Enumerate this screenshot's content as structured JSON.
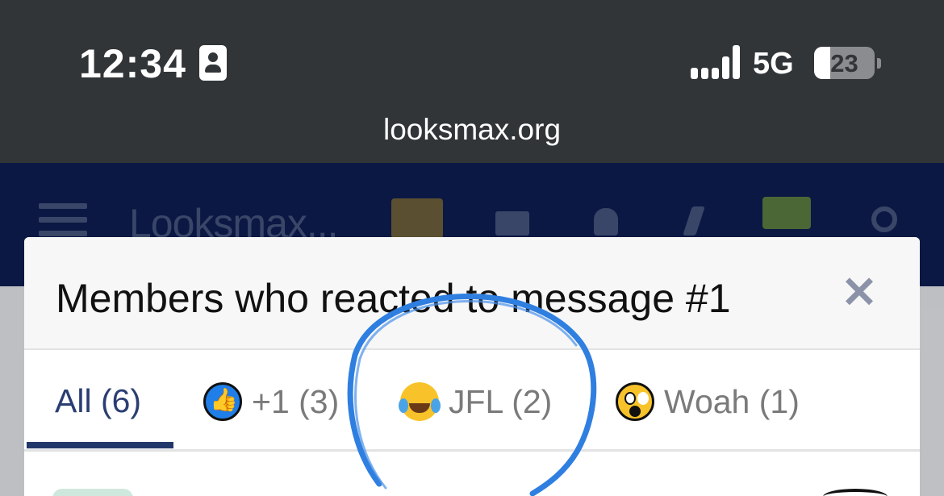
{
  "status_bar": {
    "time": "12:34",
    "network": "5G",
    "battery": "23"
  },
  "browser": {
    "url": "looksmax.org"
  },
  "site_header": {
    "logo_text": "Looksmax..."
  },
  "modal": {
    "title": "Members who reacted to message #1",
    "close_label": "✕",
    "tabs": [
      {
        "label": "All (6)",
        "icon": "none",
        "active": true
      },
      {
        "label": "+1 (3)",
        "icon": "thumbs-up-icon",
        "active": false
      },
      {
        "label": "JFL (2)",
        "icon": "crying-laughing-icon",
        "active": false
      },
      {
        "label": "Woah (1)",
        "icon": "astonished-face-icon",
        "active": false
      }
    ]
  },
  "colors": {
    "active_tab": "#2b3e73",
    "header_bg": "#0c1a48",
    "annotation": "#2f7fe0"
  }
}
